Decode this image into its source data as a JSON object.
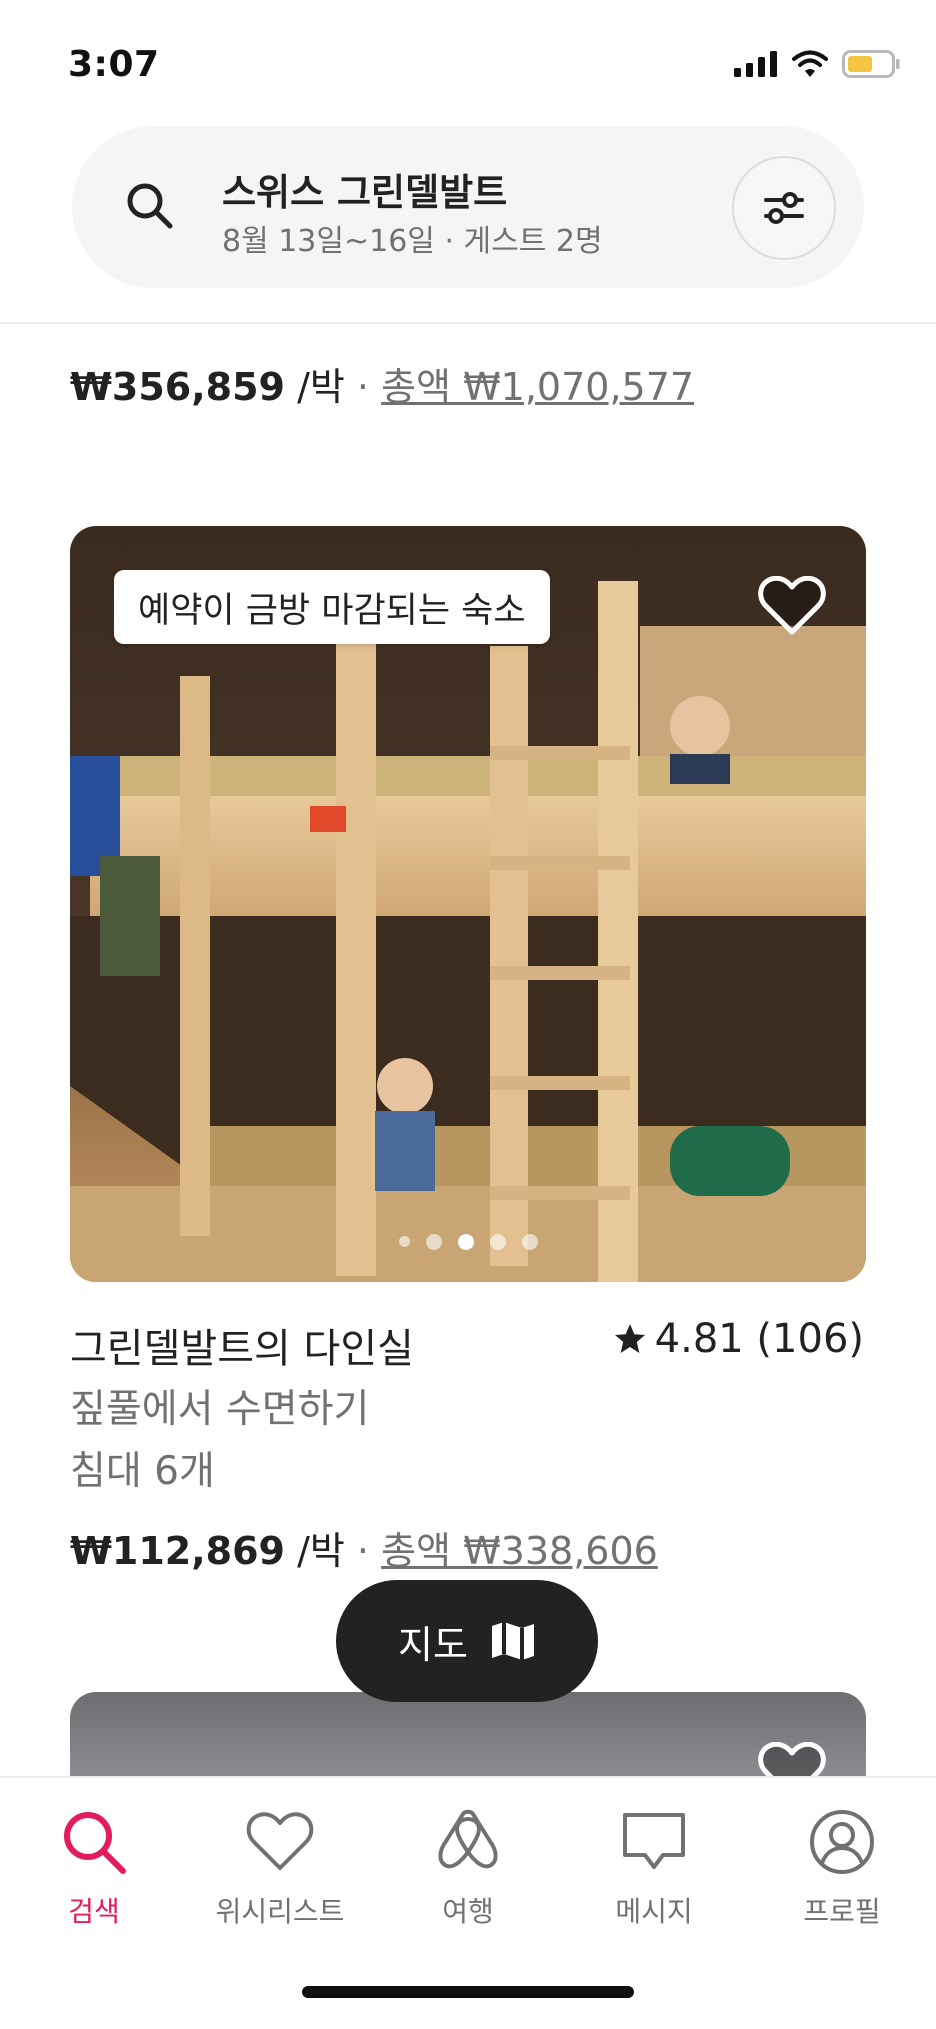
{
  "status_bar": {
    "time": "3:07"
  },
  "search": {
    "title": "스위스 그린델발트",
    "subtitle": "8월 13일~16일 · 게스트 2명"
  },
  "prev_listing": {
    "price": "₩356,859",
    "per": " /박",
    "sep": " · ",
    "total": "총액 ₩1,070,577"
  },
  "listing": {
    "badge": "예약이 금방 마감되는 숙소",
    "title": "그린델발트의 다인실",
    "rating": "4.81 (106)",
    "subtitle": "짚풀에서 수면하기",
    "beds": "침대 6개",
    "price": "₩112,869",
    "per": " /박",
    "sep": " · ",
    "total": "총액 ₩338,606",
    "photo_count": 5,
    "active_photo": 3
  },
  "map_button": {
    "label": "지도"
  },
  "tabs": [
    {
      "label": "검색",
      "icon": "search-icon",
      "active": true
    },
    {
      "label": "위시리스트",
      "icon": "heart-icon",
      "active": false
    },
    {
      "label": "여행",
      "icon": "airbnb-logo-icon",
      "active": false
    },
    {
      "label": "메시지",
      "icon": "message-icon",
      "active": false
    },
    {
      "label": "프로필",
      "icon": "profile-icon",
      "active": false
    }
  ],
  "colors": {
    "accent": "#E31C5F",
    "text": "#222222",
    "secondary": "#717171",
    "map_button": "#222222",
    "battery": "#F5C542"
  }
}
